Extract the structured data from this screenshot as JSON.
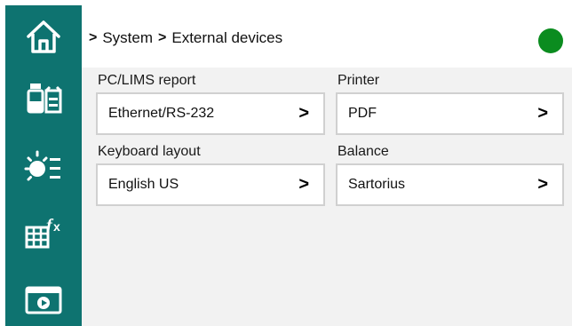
{
  "sidebar": {
    "items": [
      {
        "icon": "home-icon"
      },
      {
        "icon": "lab-samples-icon"
      },
      {
        "icon": "timer-list-icon"
      },
      {
        "icon": "formula-table-icon"
      },
      {
        "icon": "video-window-icon"
      }
    ],
    "color": "#0e7370"
  },
  "header": {
    "breadcrumb": [
      {
        "sep": ">",
        "label": "System"
      },
      {
        "sep": ">",
        "label": "External devices"
      }
    ],
    "status_color": "#0b8c1f"
  },
  "settings": [
    {
      "label": "PC/LIMS report",
      "value": "Ethernet/RS-232"
    },
    {
      "label": "Printer",
      "value": "PDF"
    },
    {
      "label": "Keyboard layout",
      "value": "English US"
    },
    {
      "label": "Balance",
      "value": "Sartorius"
    }
  ],
  "chevron": ">"
}
